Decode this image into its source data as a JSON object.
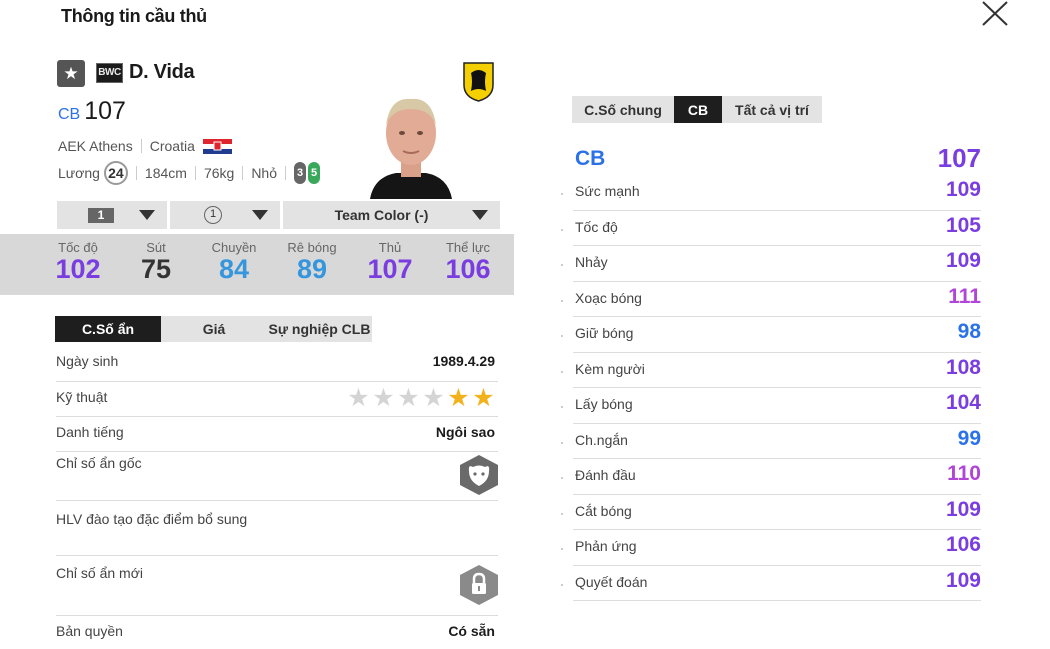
{
  "header": {
    "title": "Thông tin cầu thủ"
  },
  "player": {
    "season_badge": "BWC",
    "name": "D. Vida",
    "position": "CB",
    "overall": "107",
    "club": "AEK Athens",
    "nation": "Croatia",
    "wage_label": "Lương",
    "wage": "24",
    "height": "184cm",
    "weight": "76kg",
    "body_type": "Nhỏ",
    "weak_foot_left": "3",
    "weak_foot_right": "5"
  },
  "selectors": {
    "level": "1",
    "team_color_rank": "1",
    "team_color": "Team Color (-)"
  },
  "main_stats": [
    {
      "label": "Tốc độ",
      "value": "102",
      "color": "#7a3de0"
    },
    {
      "label": "Sút",
      "value": "75",
      "color": "#333333"
    },
    {
      "label": "Chuyền",
      "value": "84",
      "color": "#3596dd"
    },
    {
      "label": "Rê bóng",
      "value": "89",
      "color": "#3596dd"
    },
    {
      "label": "Thủ",
      "value": "107",
      "color": "#7a3de0"
    },
    {
      "label": "Thể lực",
      "value": "106",
      "color": "#7a3de0"
    }
  ],
  "info_tabs": [
    "C.Số ẩn",
    "Giá",
    "Sự nghiệp CLB"
  ],
  "info": {
    "birth_label": "Ngày sinh",
    "birth_value": "1989.4.29",
    "skill_label": "Kỹ thuật",
    "skill_stars": 2,
    "fame_label": "Danh tiếng",
    "fame_value": "Ngôi sao",
    "base_traits_label": "Chỉ số ẩn gốc",
    "coach_traits_label": "HLV đào tạo đặc điểm bổ sung",
    "new_traits_label": "Chỉ số ẩn mới",
    "license_label": "Bản quyền",
    "license_value": "Có sẵn"
  },
  "stat_tabs": [
    "C.Số chung",
    "CB",
    "Tất cả vị trí"
  ],
  "position_rating": {
    "position": "CB",
    "value": "107"
  },
  "detail_stats": [
    {
      "label": "Sức mạnh",
      "value": "109",
      "color": "#7a3de0"
    },
    {
      "label": "Tốc độ",
      "value": "105",
      "color": "#7a3de0"
    },
    {
      "label": "Nhảy",
      "value": "109",
      "color": "#7a3de0"
    },
    {
      "label": "Xoạc bóng",
      "value": "111",
      "color": "#b045d8"
    },
    {
      "label": "Giữ bóng",
      "value": "98",
      "color": "#2b72e8"
    },
    {
      "label": "Kèm người",
      "value": "108",
      "color": "#7a3de0"
    },
    {
      "label": "Lấy bóng",
      "value": "104",
      "color": "#7a3de0"
    },
    {
      "label": "Ch.ngắn",
      "value": "99",
      "color": "#2b72e8"
    },
    {
      "label": "Đánh đầu",
      "value": "110",
      "color": "#b045d8"
    },
    {
      "label": "Cắt bóng",
      "value": "109",
      "color": "#7a3de0"
    },
    {
      "label": "Phản ứng",
      "value": "106",
      "color": "#7a3de0"
    },
    {
      "label": "Quyết đoán",
      "value": "109",
      "color": "#7a3de0"
    }
  ]
}
